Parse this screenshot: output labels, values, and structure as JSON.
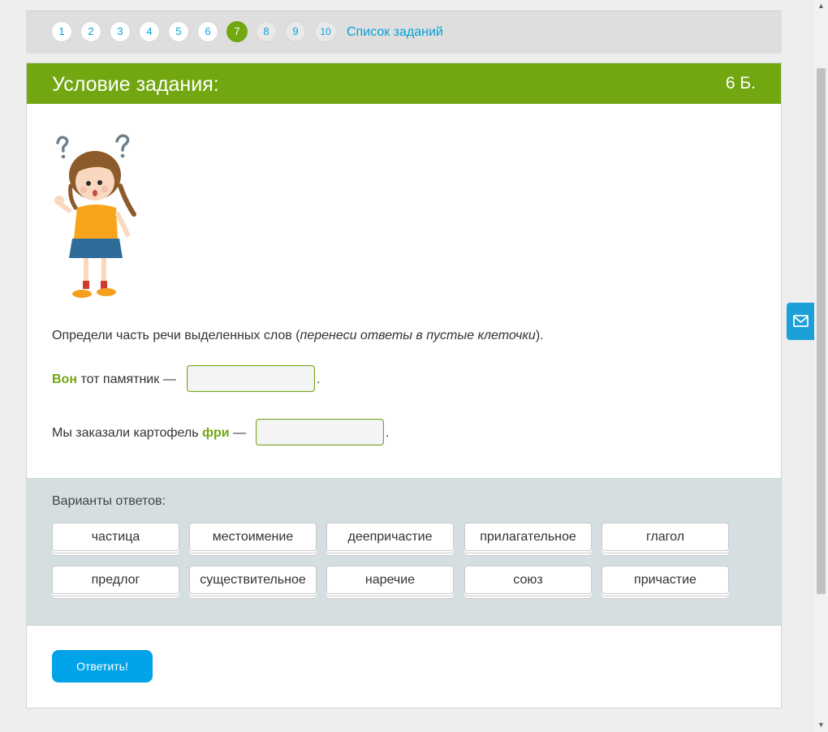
{
  "nav": {
    "numbers": [
      "1",
      "2",
      "3",
      "4",
      "5",
      "6",
      "7",
      "8",
      "9",
      "10"
    ],
    "list_link": "Список заданий"
  },
  "task": {
    "title": "Условие задания:",
    "points": "6 Б.",
    "instruction_start": "Определи часть речи выделенных слов (",
    "instruction_italic": "перенеси ответы в пустые клеточки",
    "instruction_end": ").",
    "q1": {
      "highlight": "Вон",
      "rest": " тот памятник — ",
      "dot": "."
    },
    "q2": {
      "before": "Мы заказали картофель ",
      "highlight": "фри",
      "after": " — ",
      "dot": "."
    }
  },
  "answers": {
    "title": "Варианты ответов:",
    "options": [
      "частица",
      "местоимение",
      "деепричастие",
      "прилагательное",
      "глагол",
      "предлог",
      "существительное",
      "наречие",
      "союз",
      "причастие"
    ]
  },
  "submit_label": "Ответить!",
  "colors": {
    "accent_green": "#72a712",
    "link_blue": "#00a3d9",
    "button_blue": "#00a3e8"
  }
}
